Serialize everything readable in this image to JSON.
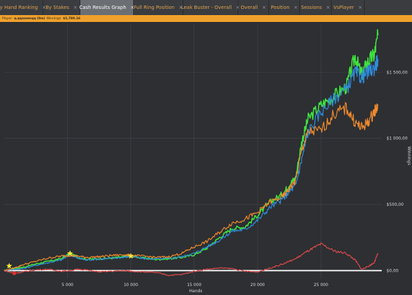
{
  "tabs": [
    {
      "label": "By Hand Ranking",
      "active": false,
      "w": 63
    },
    {
      "label": "By Stakes",
      "active": false,
      "w": 54
    },
    {
      "label": "Cash Results Graph",
      "active": true,
      "w": 78
    },
    {
      "label": "Full Ring Position",
      "active": false,
      "w": 72
    },
    {
      "label": "Leak Buster - Overall",
      "active": false,
      "w": 80
    },
    {
      "label": "Overall",
      "active": false,
      "w": 45
    },
    {
      "label": "Position",
      "active": false,
      "w": 45
    },
    {
      "label": "Sessions",
      "active": false,
      "w": 46
    },
    {
      "label": "VsPlayer",
      "active": false,
      "w": 48
    }
  ],
  "infobar": {
    "player_label": "Player:",
    "player_name": "q.qqaaamqq (8m)",
    "winnings_label": "Winnings:",
    "winnings_value": "$1,780.16"
  },
  "chart_data": {
    "type": "line",
    "xlabel": "Hands",
    "ylabel": "Winnings",
    "xlim": [
      0,
      29800
    ],
    "ylim": [
      -60,
      1860
    ],
    "x_ticks": [
      5000,
      10000,
      15000,
      20000,
      25000
    ],
    "x_tick_labels": [
      "5 000",
      "10 000",
      "15 000",
      "20 000",
      "25 000"
    ],
    "y_ticks": [
      0,
      500,
      1000,
      1500
    ],
    "y_tick_labels": [
      "$0,00",
      "$500,00",
      "$1 000,00",
      "$1 500,00"
    ],
    "y_axis_side": "right",
    "grid": true,
    "zero_line": true,
    "series": [
      {
        "color": "#3fe23f",
        "points": [
          [
            0,
            0
          ],
          [
            800,
            15
          ],
          [
            1500,
            25
          ],
          [
            2500,
            50
          ],
          [
            3500,
            70
          ],
          [
            4500,
            90
          ],
          [
            5200,
            130
          ],
          [
            5800,
            100
          ],
          [
            6500,
            85
          ],
          [
            7500,
            90
          ],
          [
            8500,
            95
          ],
          [
            9500,
            105
          ],
          [
            10000,
            110
          ],
          [
            11000,
            95
          ],
          [
            12000,
            85
          ],
          [
            13000,
            90
          ],
          [
            14000,
            100
          ],
          [
            15000,
            120
          ],
          [
            16000,
            170
          ],
          [
            17000,
            250
          ],
          [
            18000,
            320
          ],
          [
            19000,
            330
          ],
          [
            20000,
            420
          ],
          [
            21000,
            520
          ],
          [
            22000,
            580
          ],
          [
            22500,
            650
          ],
          [
            23000,
            700
          ],
          [
            23500,
            980
          ],
          [
            24000,
            1150
          ],
          [
            25000,
            1250
          ],
          [
            26000,
            1320
          ],
          [
            27000,
            1390
          ],
          [
            27700,
            1620
          ],
          [
            28200,
            1480
          ],
          [
            28700,
            1580
          ],
          [
            29200,
            1630
          ],
          [
            29500,
            1780
          ]
        ]
      },
      {
        "color": "#2e8de0",
        "points": [
          [
            0,
            0
          ],
          [
            800,
            10
          ],
          [
            1500,
            15
          ],
          [
            2500,
            40
          ],
          [
            3500,
            60
          ],
          [
            4500,
            80
          ],
          [
            5200,
            120
          ],
          [
            5800,
            95
          ],
          [
            6500,
            80
          ],
          [
            7500,
            88
          ],
          [
            8500,
            92
          ],
          [
            9500,
            102
          ],
          [
            10000,
            108
          ],
          [
            11000,
            92
          ],
          [
            12000,
            88
          ],
          [
            13000,
            92
          ],
          [
            14000,
            105
          ],
          [
            15000,
            130
          ],
          [
            16000,
            180
          ],
          [
            17000,
            230
          ],
          [
            18000,
            300
          ],
          [
            19000,
            310
          ],
          [
            20000,
            380
          ],
          [
            21000,
            480
          ],
          [
            22000,
            540
          ],
          [
            22500,
            600
          ],
          [
            23000,
            640
          ],
          [
            23500,
            850
          ],
          [
            24000,
            1050
          ],
          [
            25000,
            1200
          ],
          [
            26000,
            1300
          ],
          [
            27000,
            1370
          ],
          [
            27700,
            1500
          ],
          [
            28200,
            1460
          ],
          [
            28700,
            1500
          ],
          [
            29200,
            1530
          ],
          [
            29500,
            1600
          ]
        ]
      },
      {
        "color": "#f08a2c",
        "points": [
          [
            0,
            0
          ],
          [
            800,
            20
          ],
          [
            1500,
            45
          ],
          [
            2500,
            70
          ],
          [
            3500,
            95
          ],
          [
            4500,
            110
          ],
          [
            5200,
            115
          ],
          [
            5800,
            110
          ],
          [
            6500,
            100
          ],
          [
            7500,
            105
          ],
          [
            8500,
            115
          ],
          [
            9500,
            120
          ],
          [
            10000,
            115
          ],
          [
            11000,
            110
          ],
          [
            12000,
            100
          ],
          [
            13000,
            105
          ],
          [
            14000,
            130
          ],
          [
            15000,
            180
          ],
          [
            16000,
            220
          ],
          [
            17000,
            290
          ],
          [
            18000,
            360
          ],
          [
            19000,
            390
          ],
          [
            20000,
            440
          ],
          [
            21000,
            520
          ],
          [
            22000,
            560
          ],
          [
            22500,
            620
          ],
          [
            23000,
            680
          ],
          [
            23500,
            920
          ],
          [
            24000,
            1050
          ],
          [
            25000,
            1060
          ],
          [
            26000,
            1180
          ],
          [
            27000,
            1230
          ],
          [
            27700,
            1120
          ],
          [
            28200,
            1080
          ],
          [
            28700,
            1120
          ],
          [
            29200,
            1200
          ],
          [
            29500,
            1250
          ]
        ]
      },
      {
        "color": "#e04848",
        "points": [
          [
            0,
            0
          ],
          [
            800,
            -20
          ],
          [
            1500,
            -10
          ],
          [
            2500,
            5
          ],
          [
            3500,
            10
          ],
          [
            4500,
            -5
          ],
          [
            5200,
            0
          ],
          [
            5800,
            10
          ],
          [
            6500,
            5
          ],
          [
            7500,
            -10
          ],
          [
            8500,
            -5
          ],
          [
            9500,
            0
          ],
          [
            10000,
            -5
          ],
          [
            11000,
            -10
          ],
          [
            12000,
            -15
          ],
          [
            13000,
            -35
          ],
          [
            14000,
            -30
          ],
          [
            15000,
            -5
          ],
          [
            16000,
            10
          ],
          [
            17000,
            20
          ],
          [
            18000,
            15
          ],
          [
            19000,
            -5
          ],
          [
            20000,
            -10
          ],
          [
            21000,
            20
          ],
          [
            22000,
            50
          ],
          [
            23000,
            90
          ],
          [
            24000,
            150
          ],
          [
            25000,
            200
          ],
          [
            26000,
            150
          ],
          [
            27000,
            130
          ],
          [
            27700,
            80
          ],
          [
            28200,
            10
          ],
          [
            28700,
            30
          ],
          [
            29200,
            60
          ],
          [
            29500,
            130
          ]
        ]
      }
    ],
    "markers": [
      {
        "type": "star",
        "color": "#f6e83a",
        "x": 400,
        "y": 35
      },
      {
        "type": "star",
        "color": "#f6e83a",
        "x": 5200,
        "y": 130
      },
      {
        "type": "star",
        "color": "#f6e83a",
        "x": 10000,
        "y": 110
      },
      {
        "type": "dot",
        "color": "#e03030",
        "x": 800,
        "y": -20
      }
    ]
  }
}
